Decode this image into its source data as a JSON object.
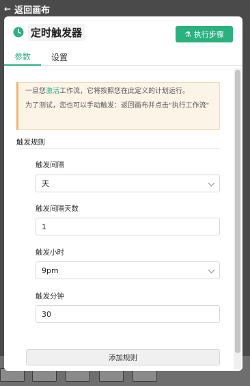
{
  "topbar": {
    "back_label": "返回画布"
  },
  "panel": {
    "title": "定时触发器",
    "run_button": "执行步骤",
    "tabs": [
      {
        "label": "参数",
        "active": true
      },
      {
        "label": "设置",
        "active": false
      }
    ],
    "notice": {
      "line1_prefix": "一旦您",
      "line1_highlight": "激活",
      "line1_suffix": "工作流，它将按照您在此定义的计划运行。",
      "line2": "为了测试，您也可以手动触发：返回画布并点击\"执行工作流\""
    },
    "section_title": "触发规则",
    "fields": [
      {
        "label": "触发间隔",
        "value": "天",
        "type": "select"
      },
      {
        "label": "触发间隔天数",
        "value": "1",
        "type": "input"
      },
      {
        "label": "触发小时",
        "value": "9pm",
        "type": "select"
      },
      {
        "label": "触发分钟",
        "value": "30",
        "type": "input"
      }
    ],
    "add_rule_button": "添加规则"
  },
  "colors": {
    "accent": "#2bb07f",
    "notice_bg": "#fdf4e8",
    "notice_border": "#f0b46a"
  },
  "icons": {
    "header": "clock-icon",
    "run": "flask-icon",
    "back": "back-arrow-icon"
  }
}
